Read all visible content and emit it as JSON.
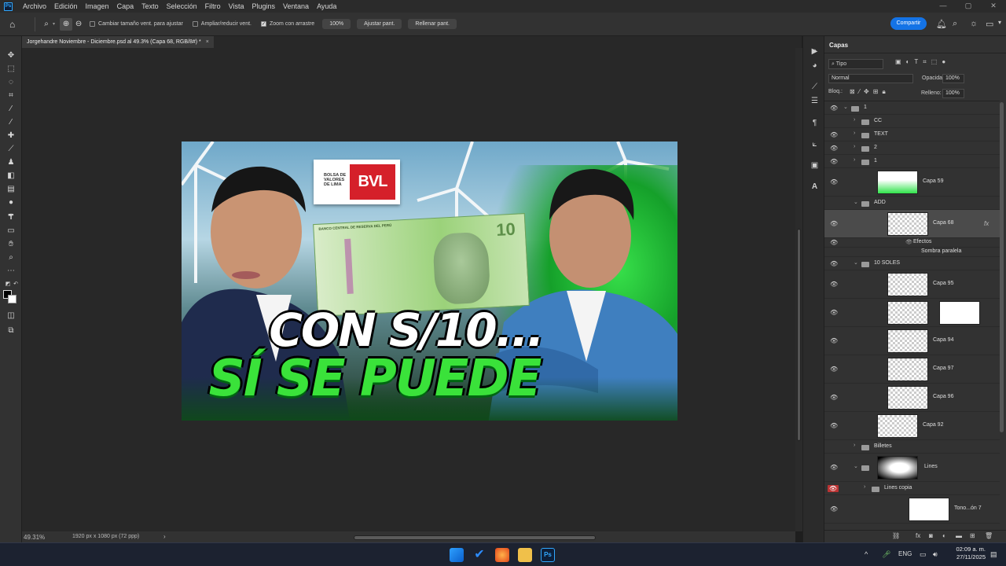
{
  "menu": {
    "app_icon": "Ps",
    "items": [
      "Archivo",
      "Edición",
      "Imagen",
      "Capa",
      "Texto",
      "Selección",
      "Filtro",
      "Vista",
      "Plugins",
      "Ventana",
      "Ayuda"
    ]
  },
  "window_controls": {
    "minimize": "—",
    "maximize": "▢",
    "close": "✕"
  },
  "options_bar": {
    "resize_windows_label": "Cambiar tamaño vent. para ajustar",
    "zoom_all_windows_label": "Ampliar/reducir vent.",
    "scrubby_zoom_label": "Zoom con arrastre",
    "zoom_100": "100%",
    "fit_screen": "Ajustar pant.",
    "fill_screen": "Rellenar pant.",
    "share_button": "Compartir"
  },
  "document": {
    "tab_title": "Jorgehandre Noviembre - Diciembre.psd al 49.3% (Capa 68, RGB/8#) *",
    "zoom_status": "49.31%",
    "doc_info": "1920 px x 1080 px (72 ppp)"
  },
  "artwork": {
    "logo_text": "BOLSA DE VALORES DE LIMA",
    "logo_mark": "BVL",
    "bill_title": "BANCO CENTRAL DE RESERVA DEL PERÚ",
    "bill_number": "10",
    "headline_1": "CON S/10...",
    "headline_2": "SÍ SE PUEDE"
  },
  "layers_panel": {
    "tab_label": "Capas",
    "filter_type": "Tipo",
    "blend_mode": "Normal",
    "opacity_label": "Opacidad:",
    "opacity_value": "100%",
    "lock_label": "Bloq.:",
    "fill_label": "Relleno:",
    "fill_value": "100%",
    "layers": [
      {
        "name": "1",
        "kind": "group-open",
        "indent": 0,
        "visible": true
      },
      {
        "name": "CC",
        "kind": "group",
        "indent": 1,
        "visible": false
      },
      {
        "name": "TEXT",
        "kind": "group",
        "indent": 1,
        "visible": true
      },
      {
        "name": "2",
        "kind": "group",
        "indent": 1,
        "visible": true
      },
      {
        "name": "1",
        "kind": "group",
        "indent": 1,
        "visible": true
      },
      {
        "name": "Capa 59",
        "kind": "layer-green",
        "indent": 1,
        "visible": true
      },
      {
        "name": "ADD",
        "kind": "group-open",
        "indent": 1,
        "visible": false
      },
      {
        "name": "Capa 68",
        "kind": "layer",
        "indent": 2,
        "visible": true,
        "selected": true,
        "fx": true
      },
      {
        "name": "Efectos",
        "kind": "effects",
        "indent": 3,
        "visible": true
      },
      {
        "name": "Sombra paralela",
        "kind": "effect",
        "indent": 3,
        "visible": false
      },
      {
        "name": "10 SOLES",
        "kind": "group-open",
        "indent": 1,
        "visible": true
      },
      {
        "name": "Capa 95",
        "kind": "layer",
        "indent": 2,
        "visible": true
      },
      {
        "name": "",
        "kind": "layer-mask",
        "indent": 2,
        "visible": true
      },
      {
        "name": "Capa 94",
        "kind": "layer",
        "indent": 2,
        "visible": true
      },
      {
        "name": "Capa 97",
        "kind": "layer",
        "indent": 2,
        "visible": true
      },
      {
        "name": "Capa 96",
        "kind": "layer",
        "indent": 2,
        "visible": true
      },
      {
        "name": "Capa 92",
        "kind": "layer",
        "indent": 1,
        "visible": true
      },
      {
        "name": "Billetes",
        "kind": "group",
        "indent": 1,
        "visible": false
      },
      {
        "name": "Lines",
        "kind": "group-gradient",
        "indent": 1,
        "visible": true
      },
      {
        "name": "Lines copia",
        "kind": "group",
        "indent": 2,
        "visible": true,
        "red": true
      },
      {
        "name": "Tono...ón 7",
        "kind": "adjustment",
        "indent": 1,
        "visible": true
      }
    ]
  },
  "taskbar": {
    "language": "ENG",
    "time": "02:09 a. m.",
    "date": "27/11/2025"
  }
}
